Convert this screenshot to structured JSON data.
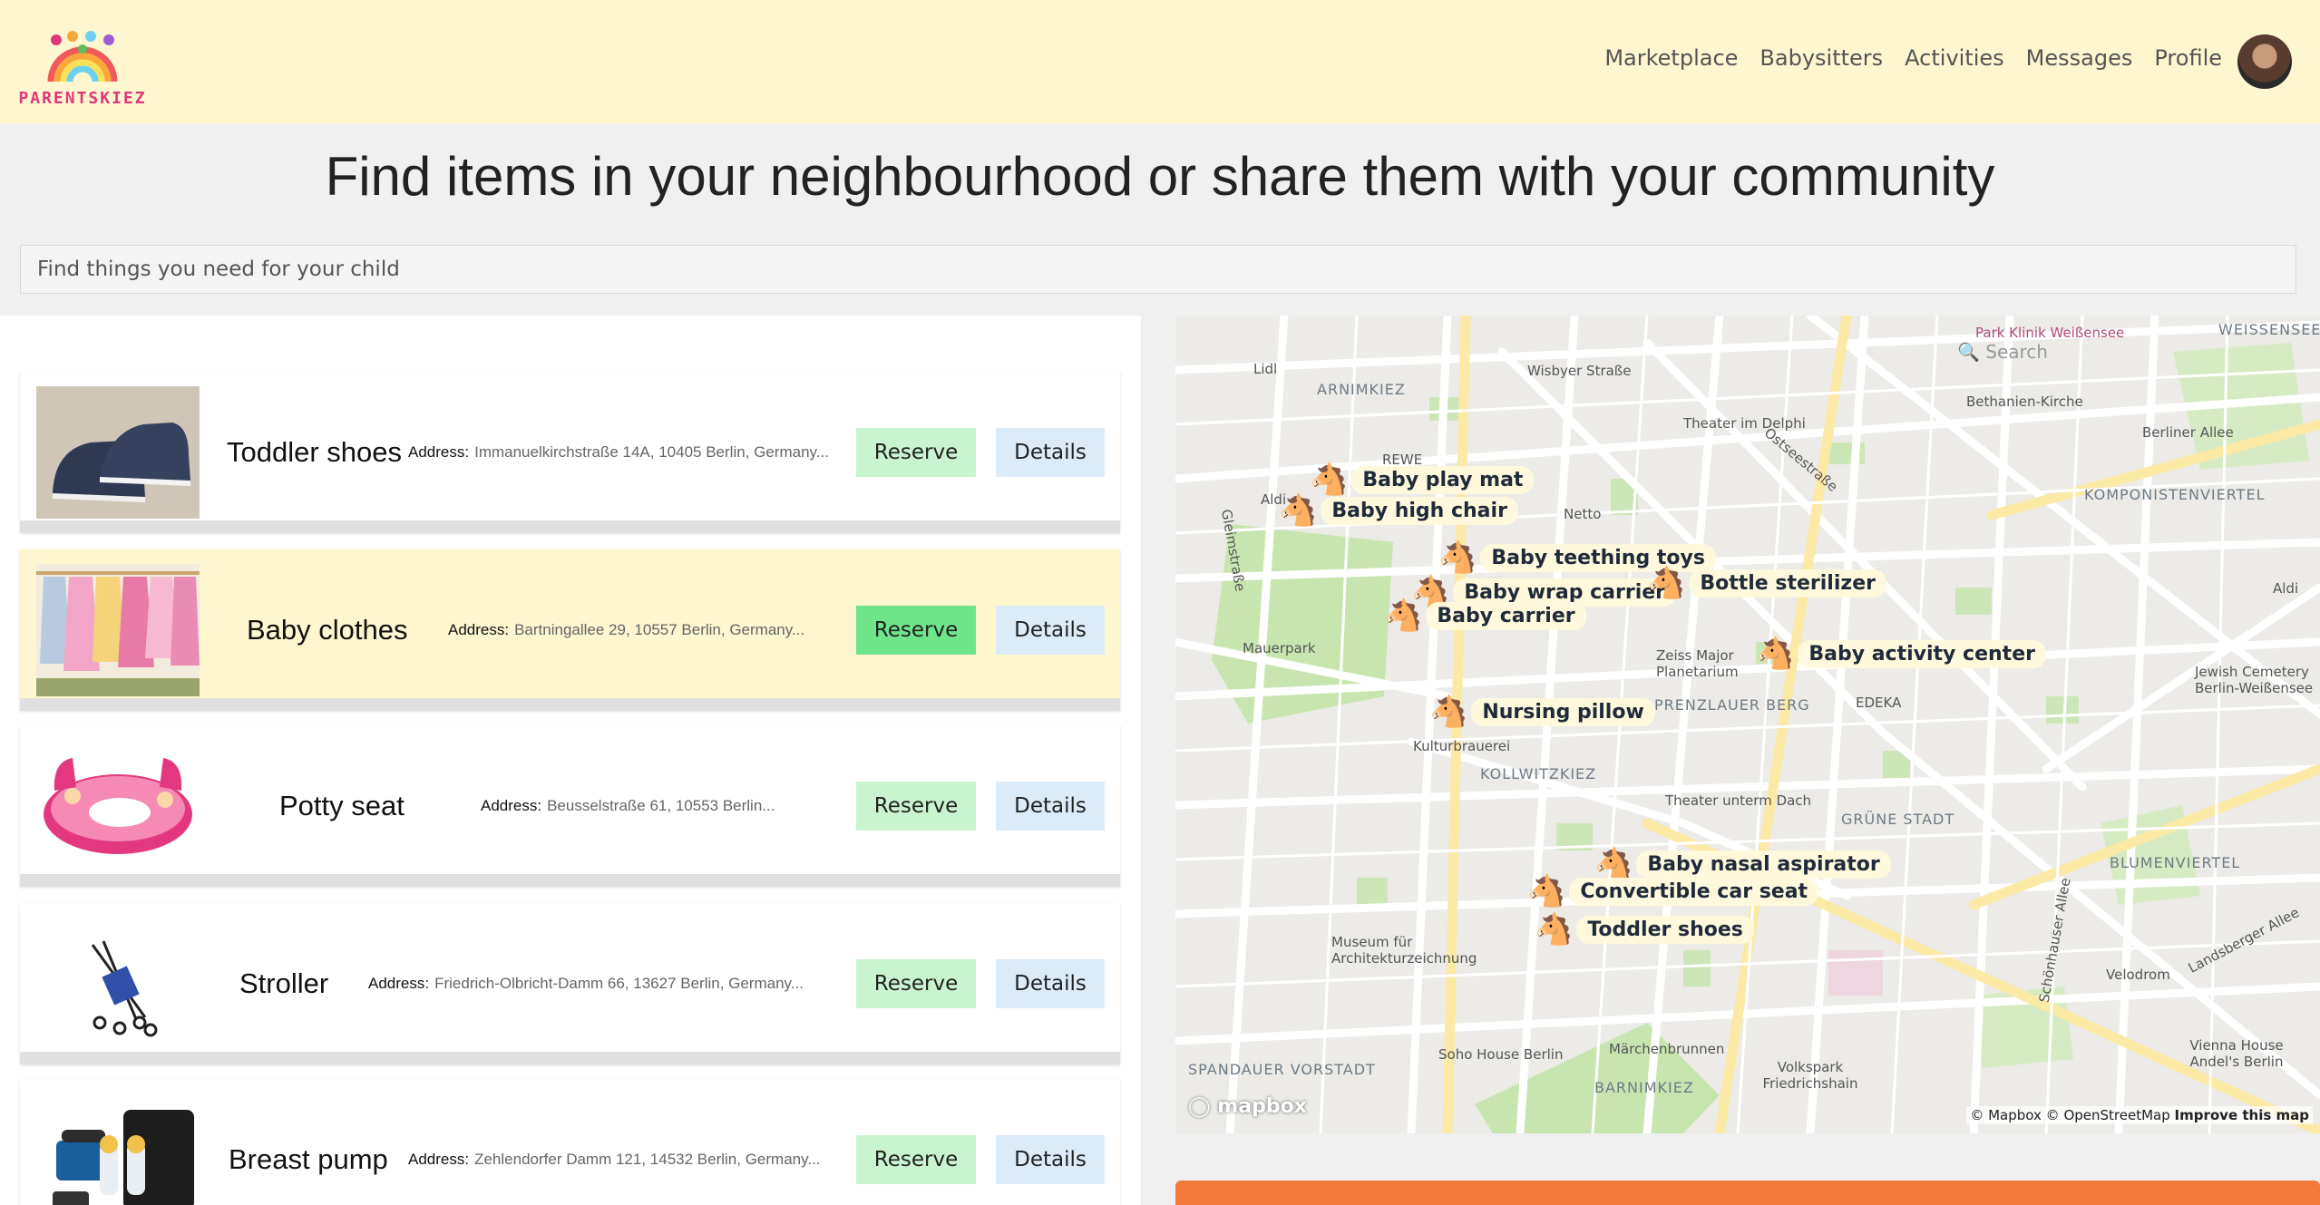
{
  "brand": {
    "name": "PARENTSKIEZ"
  },
  "nav": {
    "links": [
      "Marketplace",
      "Babysitters",
      "Activities",
      "Messages",
      "Profile"
    ]
  },
  "page": {
    "title": "Find items in your neighbourhood or share them with your community"
  },
  "search": {
    "placeholder": "Find things you need for your child"
  },
  "items": [
    {
      "name": "Toddler shoes",
      "address_label": "Address:",
      "address": "Immanuelkirchstraße 14A, 10405 Berlin, Germany...",
      "reserve": "Reserve",
      "details": "Details",
      "highlighted": false
    },
    {
      "name": "Baby clothes",
      "address_label": "Address:",
      "address": "Bartningallee 29, 10557 Berlin, Germany...",
      "reserve": "Reserve",
      "details": "Details",
      "highlighted": true
    },
    {
      "name": "Potty seat",
      "address_label": "Address:",
      "address": "Beusselstraße 61, 10553 Berlin...",
      "reserve": "Reserve",
      "details": "Details",
      "highlighted": false
    },
    {
      "name": "Stroller",
      "address_label": "Address:",
      "address": "Friedrich-Olbricht-Damm 66, 13627 Berlin, Germany...",
      "reserve": "Reserve",
      "details": "Details",
      "highlighted": false
    },
    {
      "name": "Breast pump",
      "address_label": "Address:",
      "address": "Zehlendorfer Damm 121, 14532 Berlin, Germany...",
      "reserve": "Reserve",
      "details": "Details",
      "highlighted": false
    }
  ],
  "map": {
    "search_placeholder": "Search",
    "markers": [
      "Baby play mat",
      "Baby high chair",
      "Baby teething toys",
      "Baby wrap carrier",
      "Baby carrier",
      "Bottle sterilizer",
      "Baby activity center",
      "Nursing pillow",
      "Baby nasal aspirator",
      "Convertible car seat",
      "Toddler shoes"
    ],
    "labels": {
      "arnimkiez": "ARNIMKIEZ",
      "weissensee": "WEISSENSEE",
      "komponistenviertel": "KOMPONISTENVIERTEL",
      "prenzlauer_berg": "PRENZLAUER BERG",
      "kollwitzkiez": "KOLLWITZKIEZ",
      "gruene_stadt": "GRÜNE STADT",
      "blumenviertel": "BLUMENVIERTEL",
      "spandauer_vorstadt": "SPANDAUER VORSTADT",
      "barnimkiez": "BARNIMKIEZ",
      "mauerpark": "Mauerpark",
      "lidl": "Lidl",
      "aldi_n": "Aldi",
      "aldi_e": "Aldi",
      "rewe": "REWE",
      "netto": "Netto",
      "edeka": "EDEKA",
      "wisbyer": "Wisbyer Straße",
      "theater_delphi": "Theater im Delphi",
      "bethanien": "Bethanien-Kirche",
      "park_klinik": "Park Klinik Weißensee",
      "berliner_allee": "Berliner Allee",
      "zeiss": "Zeiss Major Planetarium",
      "kulturbrauerei": "Kulturbrauerei",
      "theater_dach": "Theater unterm Dach",
      "velodrom": "Velodrom",
      "museum_arch": "Museum für Architekturzeichnung",
      "soho": "Soho House Berlin",
      "maerchenbrunnen": "Märchenbrunnen",
      "volkspark": "Volkspark Friedrichshain",
      "vienna": "Vienna House Andel's Berlin",
      "jewish_cemetery": "Jewish Cemetery Berlin-Weißensee",
      "landsberger": "Landsberger Allee",
      "ostseestrasse": "Ostseestraße",
      "gleimstrasse": "Gleimstraße",
      "schoenhauser": "Schönhauser Allee"
    },
    "attribution": {
      "mapbox": "© Mapbox",
      "osm": "© OpenStreetMap",
      "improve": "Improve this map"
    },
    "logo": "mapbox"
  },
  "colors": {
    "navbar_bg": "#fdf6cf",
    "reserve_bg": "#c8f5cf",
    "reserve_active_bg": "#6fe58a",
    "details_bg": "#dcebf8",
    "cta_orange": "#f47a3a",
    "logo_pink": "#e2367a"
  }
}
